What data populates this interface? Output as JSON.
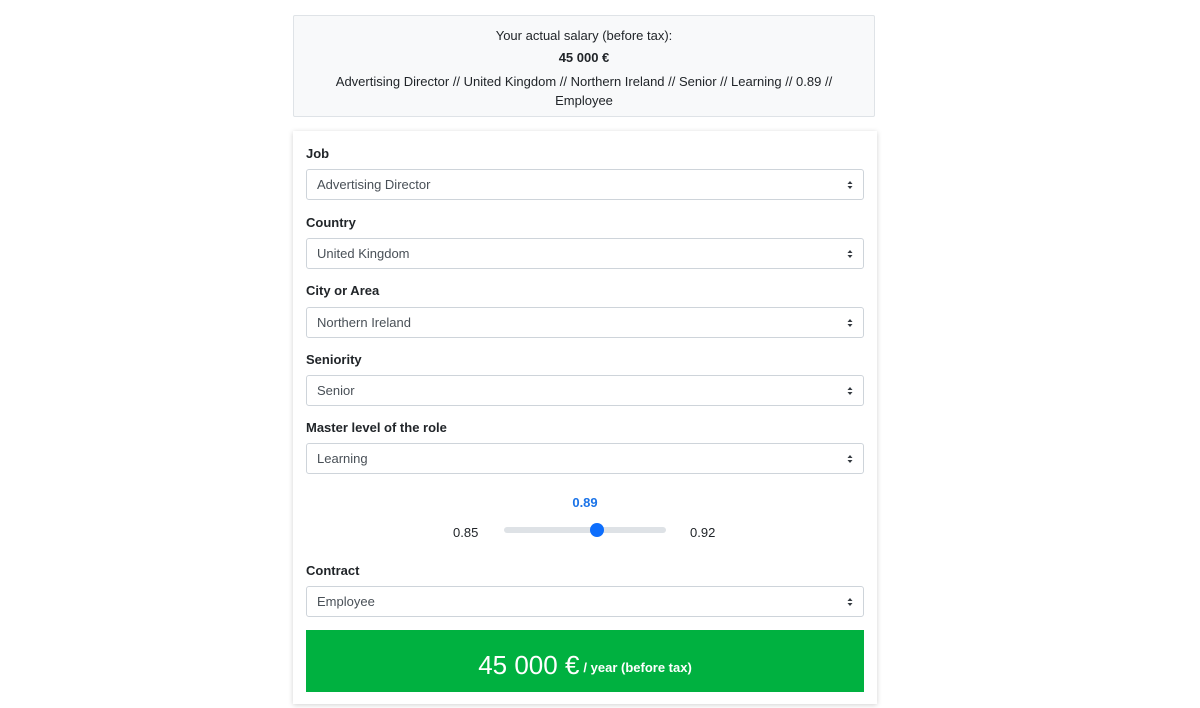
{
  "summary": {
    "intro": "Your actual salary (before tax):",
    "amount": "45 000 €",
    "details": "Advertising Director // United Kingdom // Northern Ireland // Senior // Learning // 0.89 // Employee"
  },
  "form": {
    "job": {
      "label": "Job",
      "value": "Advertising Director"
    },
    "country": {
      "label": "Country",
      "value": "United Kingdom"
    },
    "city": {
      "label": "City or Area",
      "value": "Northern Ireland"
    },
    "seniority": {
      "label": "Seniority",
      "value": "Senior"
    },
    "master_level": {
      "label": "Master level of the role",
      "value": "Learning"
    },
    "slider": {
      "value": "0.89",
      "min": "0.85",
      "max": "0.92"
    },
    "contract": {
      "label": "Contract",
      "value": "Employee"
    }
  },
  "result": {
    "amount": "45 000 €",
    "period": "/ year (before tax)"
  },
  "colors": {
    "accent": "#0d6efd",
    "result_bg": "#00b140",
    "slider_value_text": "#1a73e8"
  }
}
